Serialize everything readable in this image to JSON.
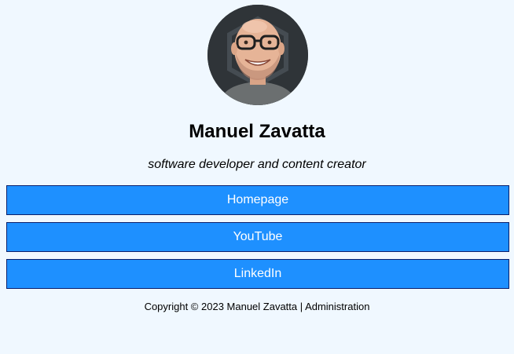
{
  "profile": {
    "name": "Manuel Zavatta",
    "tagline": "software developer and content creator"
  },
  "links": [
    {
      "label": "Homepage"
    },
    {
      "label": "YouTube"
    },
    {
      "label": "LinkedIn"
    }
  ],
  "footer": {
    "copyright": "Copyright © 2023 Manuel Zavatta",
    "separator": "|",
    "admin_link": "Administration"
  },
  "colors": {
    "background": "#f0f8ff",
    "button": "#1e90ff",
    "button_border": "#0a1f6b",
    "button_text": "#ffffff"
  },
  "icons": {
    "avatar": "profile-photo"
  }
}
